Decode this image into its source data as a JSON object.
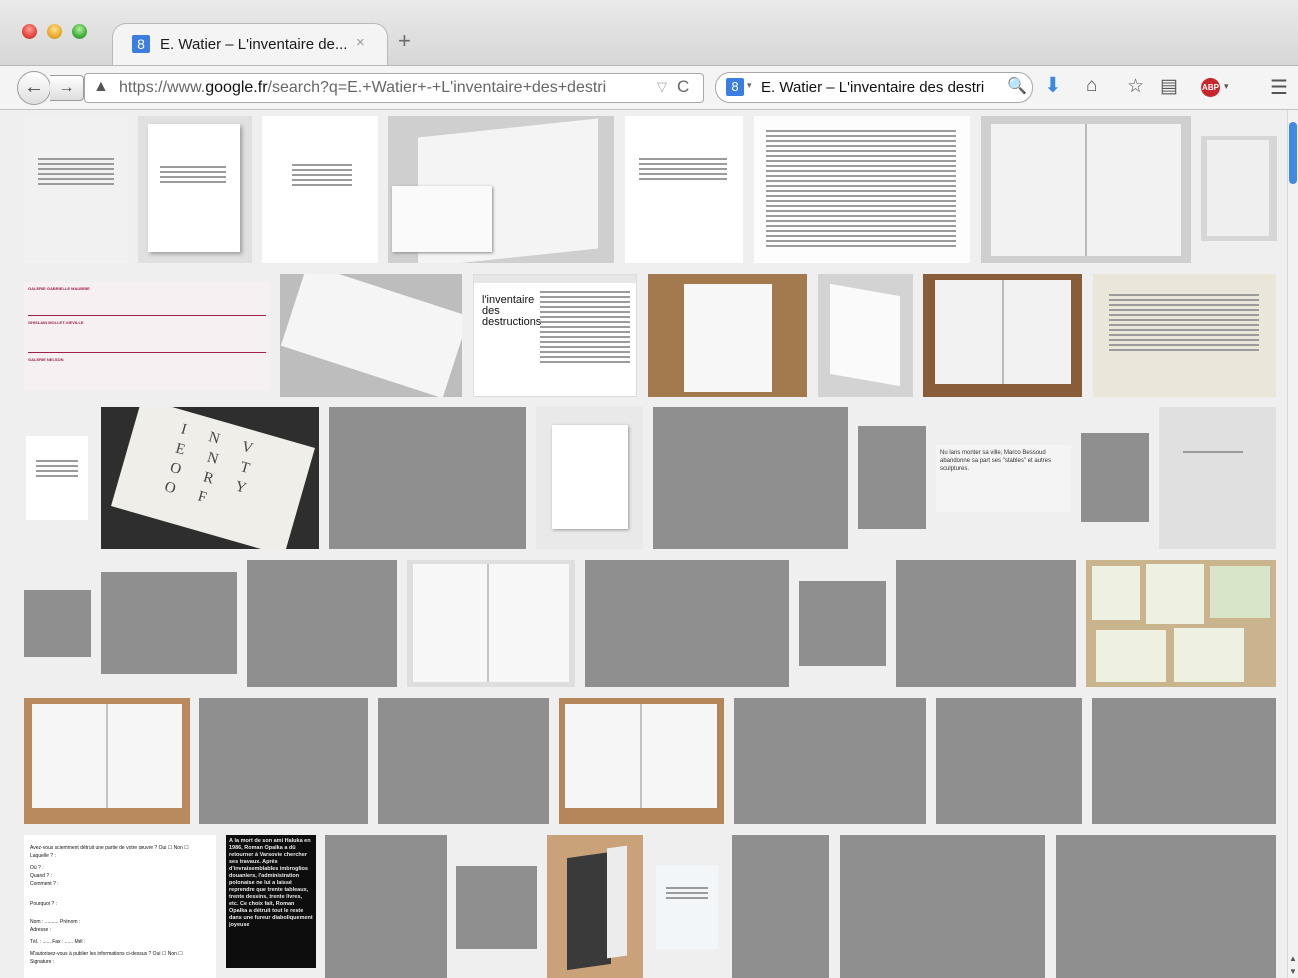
{
  "window": {
    "tab_title": "E. Watier – L'inventaire de...",
    "tab_close": "×",
    "new_tab": "+",
    "favicon_letter": "8"
  },
  "navbar": {
    "back": "←",
    "forward": "→",
    "warn": "▲",
    "url_prefix": "https://www.",
    "url_domain": "google.fr",
    "url_suffix": "/search?q=E.+Watier+-+L'inventaire+des+destri",
    "url_dropdown": "▽",
    "reload": "C",
    "search_engine_letter": "8",
    "search_engine_drop": "▾",
    "search_text": "E. Watier – L'inventaire des destri",
    "search_icon": "🔍",
    "download_icon": "⬇",
    "home_icon": "⌂",
    "bookmark_icon": "☆",
    "reader_icon": "▤",
    "abp_label": "ABP",
    "abp_drop": "▾",
    "menu_icon": "☰"
  },
  "results": {
    "inventory_book_text": "I N V E N T O R Y O F",
    "black_book_text": "À la mort de son ami Haluka en 1986, Roman Opalka a dû retourner à Varsovie chercher ses travaux. Après d'invraisemblables imbroglios douaniers, l'administration polonaise ne lui a laissé reprendre que trente tableaux, trente dessins, trente livres, etc. Ce choix fait, Roman Opalka a détruit tout le reste dans une fureur diaboliquement joyeuse",
    "magazine_title": "l'inventaire des destructions",
    "quote_text": "Nu lans monter sa ville, Marco Bessoud abandonne sa part ses \"stables\" et autres sculptures.",
    "form_lines": [
      "Avez-vous sciemment détruit une partie de votre œuvre ? Oui ☐ Non ☐",
      "Laquelle ? :",
      "Où ? :",
      "Quand ? :",
      "Comment ? :",
      "Pourquoi ? :",
      "Nom : .......... Prénom :",
      "Adresse :",
      "Tél. : ...... Fax : ...... Mél :",
      "M'autorisez-vous à publier les informations ci-dessus ? Oui ☐ Non ☐",
      "Signature :"
    ],
    "gallery_heading": "GALERIE GABRIELLE MAUBRIE",
    "gallery_heading2": "GHISLAIN MOLLET-VIEVILLE",
    "gallery_heading3": "GALERIE NELSON"
  },
  "scrollbar": {
    "up": "▲",
    "down": "▼"
  }
}
